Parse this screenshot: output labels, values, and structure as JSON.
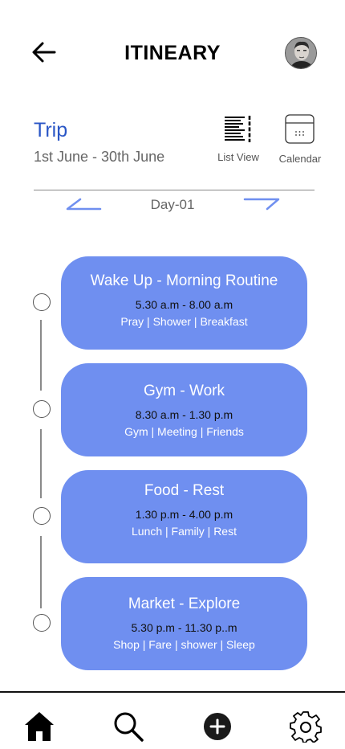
{
  "header": {
    "title": "ITINEARY"
  },
  "trip": {
    "title": "Trip",
    "dates": "1st June - 30th June"
  },
  "views": {
    "list_label": "List View",
    "calendar_label": "Calendar"
  },
  "day": {
    "label": "Day-01"
  },
  "activities": [
    {
      "title": "Wake Up - Morning Routine",
      "time": "5.30 a.m - 8.00 a.m",
      "tags": "Pray | Shower | Breakfast"
    },
    {
      "title": "Gym - Work",
      "time": "8.30 a.m - 1.30 p.m",
      "tags": "Gym | Meeting | Friends"
    },
    {
      "title": "Food - Rest",
      "time": "1.30 p.m - 4.00 p.m",
      "tags": "Lunch | Family | Rest"
    },
    {
      "title": "Market - Explore",
      "time": "5.30 p.m -  11.30 p..m",
      "tags": "Shop | Fare | shower | Sleep"
    }
  ],
  "colors": {
    "card": "#6f8ff0",
    "trip_title": "#2a56c6",
    "arrow": "#6f8ff0"
  },
  "nav": {
    "items": [
      "home-icon",
      "search-icon",
      "add-icon",
      "settings-icon"
    ]
  }
}
